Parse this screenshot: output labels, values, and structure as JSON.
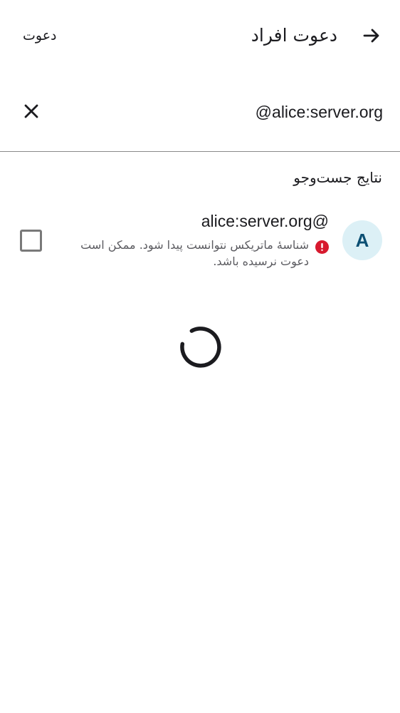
{
  "header": {
    "title": "دعوت افراد",
    "invite_action": "دعوت"
  },
  "search": {
    "value": "alice:server.org@"
  },
  "results": {
    "heading": "نتایج جست‌وجو",
    "items": [
      {
        "avatar_letter": "A",
        "user_id": "alice:server.org@",
        "warning": "شناسهٔ ماتریکس نتوانست پیدا شود. ممکن است دعوت نرسیده باشد.",
        "selected": false
      }
    ]
  },
  "colors": {
    "avatar_bg": "#dcf0f6",
    "avatar_text": "#0b4f73",
    "error": "#d7192e",
    "divider": "#8a8a8a"
  },
  "icons": {
    "back": "arrow-forward-icon",
    "clear": "close-icon",
    "warning": "error-icon",
    "loading": "progress-spinner-icon"
  }
}
